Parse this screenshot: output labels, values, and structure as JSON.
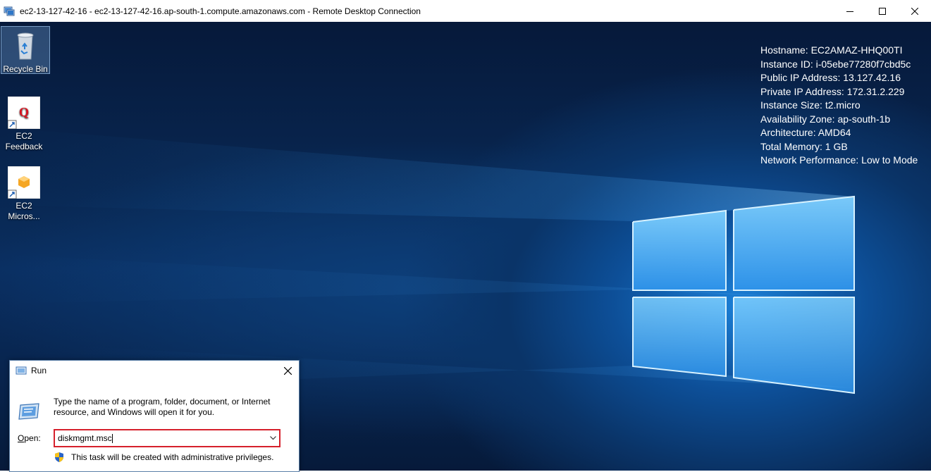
{
  "window": {
    "title": "ec2-13-127-42-16 - ec2-13-127-42-16.ap-south-1.compute.amazonaws.com - Remote Desktop Connection",
    "icon": "remote-desktop-icon",
    "controls": [
      "minimize-icon",
      "maximize-icon",
      "close-icon"
    ]
  },
  "desktop": {
    "icons": [
      {
        "label": "Recycle Bin",
        "icon": "recycle-bin-icon"
      },
      {
        "label": "EC2\nFeedback",
        "icon": "ec2-feedback-icon"
      },
      {
        "label": "EC2\nMicros...",
        "icon": "ec2-microsoft-icon"
      }
    ],
    "bginfo": [
      "Hostname: EC2AMAZ-HHQ00TI",
      "Instance ID: i-05ebe77280f7cbd5c",
      "Public IP Address: 13.127.42.16",
      "Private IP Address: 172.31.2.229",
      "Instance Size: t2.micro",
      "Availability Zone: ap-south-1b",
      "Architecture: AMD64",
      "Total Memory: 1 GB",
      "Network Performance: Low to Mode"
    ]
  },
  "run_dialog": {
    "title": "Run",
    "description": "Type the name of a program, folder, document, or Internet resource, and Windows will open it for you.",
    "open_label_prefix": "",
    "open_label_underlined": "O",
    "open_label_rest": "pen:",
    "open_value": "diskmgmt.msc",
    "admin_note": "This task will be created with administrative privileges.",
    "highlight_color": "#d6202c"
  }
}
